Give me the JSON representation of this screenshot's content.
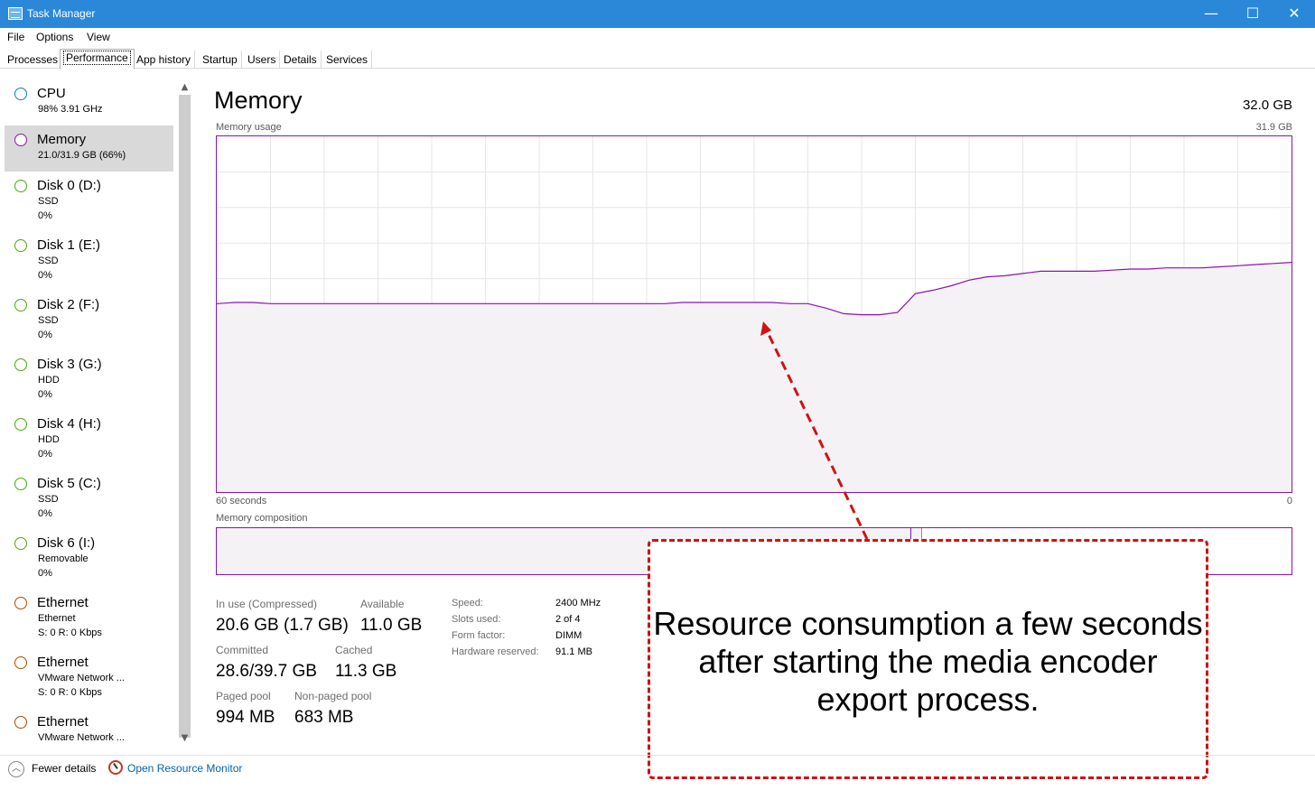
{
  "window": {
    "title": "Task Manager",
    "minimize_glyph": "—",
    "maximize_glyph": "☐",
    "close_glyph": "✕"
  },
  "menu": [
    "File",
    "Options",
    "View"
  ],
  "tabs": [
    "Processes",
    "Performance",
    "App history",
    "Startup",
    "Users",
    "Details",
    "Services"
  ],
  "active_tab": "Performance",
  "sidebar": {
    "items": [
      {
        "name": "CPU",
        "line1": "98%  3.91 GHz",
        "line2": "",
        "color": "#117dbb",
        "icon": "cpu-status-dot"
      },
      {
        "name": "Memory",
        "line1": "21.0/31.9 GB (66%)",
        "line2": "",
        "color": "#8b12ae",
        "icon": "memory-status-dot"
      },
      {
        "name": "Disk 0 (D:)",
        "line1": "SSD",
        "line2": "0%",
        "color": "#4da60c",
        "icon": "disk-status-dot"
      },
      {
        "name": "Disk 1 (E:)",
        "line1": "SSD",
        "line2": "0%",
        "color": "#4da60c",
        "icon": "disk-status-dot"
      },
      {
        "name": "Disk 2 (F:)",
        "line1": "SSD",
        "line2": "0%",
        "color": "#4da60c",
        "icon": "disk-status-dot"
      },
      {
        "name": "Disk 3 (G:)",
        "line1": "HDD",
        "line2": "0%",
        "color": "#4da60c",
        "icon": "disk-status-dot"
      },
      {
        "name": "Disk 4 (H:)",
        "line1": "HDD",
        "line2": "0%",
        "color": "#4da60c",
        "icon": "disk-status-dot"
      },
      {
        "name": "Disk 5 (C:)",
        "line1": "SSD",
        "line2": "0%",
        "color": "#4da60c",
        "icon": "disk-status-dot"
      },
      {
        "name": "Disk 6 (I:)",
        "line1": "Removable",
        "line2": "0%",
        "color": "#4da60c",
        "icon": "disk-status-dot"
      },
      {
        "name": "Ethernet",
        "line1": "Ethernet",
        "line2": "S: 0  R: 0 Kbps",
        "color": "#a74f01",
        "icon": "ethernet-status-dot"
      },
      {
        "name": "Ethernet",
        "line1": "VMware Network ...",
        "line2": "S: 0  R: 0 Kbps",
        "color": "#a74f01",
        "icon": "ethernet-status-dot"
      },
      {
        "name": "Ethernet",
        "line1": "VMware Network ...",
        "line2": "",
        "color": "#a74f01",
        "icon": "ethernet-status-dot"
      }
    ],
    "selected_index": 1
  },
  "memory": {
    "title": "Memory",
    "total": "32.0 GB",
    "usage_label": "Memory usage",
    "usage_max": "31.9 GB",
    "time_left": "60 seconds",
    "time_right": "0",
    "composition_label": "Memory composition",
    "accent_color": "#8b12ae",
    "fill_color": "#f4f2f4",
    "grid_color": "#e6e6e6",
    "stats": {
      "in_use_label": "In use (Compressed)",
      "in_use_value": "20.6 GB (1.7 GB)",
      "available_label": "Available",
      "available_value": "11.0 GB",
      "committed_label": "Committed",
      "committed_value": "28.6/39.7 GB",
      "cached_label": "Cached",
      "cached_value": "11.3 GB",
      "paged_label": "Paged pool",
      "paged_value": "994 MB",
      "nonpaged_label": "Non-paged pool",
      "nonpaged_value": "683 MB"
    },
    "specs": [
      {
        "label": "Speed:",
        "value": "2400 MHz"
      },
      {
        "label": "Slots used:",
        "value": "2 of 4"
      },
      {
        "label": "Form factor:",
        "value": "DIMM"
      },
      {
        "label": "Hardware reserved:",
        "value": "91.1 MB"
      }
    ]
  },
  "chart_data": {
    "type": "area",
    "xlabel": "",
    "ylabel": "",
    "xlim": [
      60,
      0
    ],
    "ylim": [
      0,
      31.9
    ],
    "x": [
      60,
      59,
      58,
      57,
      56,
      55,
      54,
      53,
      52,
      51,
      50,
      49,
      48,
      47,
      46,
      45,
      44,
      43,
      42,
      41,
      40,
      39,
      38,
      37,
      36,
      35,
      34,
      33,
      32,
      31,
      30,
      29,
      28,
      27,
      26,
      25,
      24,
      23,
      22,
      21,
      20,
      19,
      18,
      17,
      16,
      15,
      14,
      13,
      12,
      11,
      10,
      9,
      8,
      7,
      6,
      5,
      4,
      3,
      2,
      1,
      0
    ],
    "values": [
      16.9,
      17.0,
      17.0,
      16.9,
      16.9,
      16.9,
      16.9,
      16.9,
      16.9,
      16.9,
      16.9,
      16.9,
      16.9,
      16.9,
      16.9,
      16.9,
      16.9,
      16.9,
      16.9,
      16.9,
      16.9,
      16.9,
      16.9,
      16.9,
      16.9,
      16.9,
      17.0,
      17.0,
      17.0,
      17.0,
      17.0,
      17.0,
      16.9,
      16.9,
      16.5,
      16.0,
      15.9,
      15.9,
      16.1,
      17.8,
      18.1,
      18.5,
      19.0,
      19.3,
      19.4,
      19.6,
      19.8,
      19.8,
      19.8,
      19.8,
      19.9,
      20.0,
      20.0,
      20.1,
      20.1,
      20.1,
      20.2,
      20.3,
      20.4,
      20.5,
      20.6
    ],
    "grid": true,
    "grid_columns": 20,
    "grid_rows": 10,
    "composition": {
      "in_use_fraction": 0.646,
      "modified_fraction": 0.01
    }
  },
  "annotation": {
    "text": "Resource consumption a few seconds after starting the media encoder export process.",
    "color": "#d11212"
  },
  "footer": {
    "fewer_details": "Fewer details",
    "open_monitor": "Open Resource Monitor"
  }
}
